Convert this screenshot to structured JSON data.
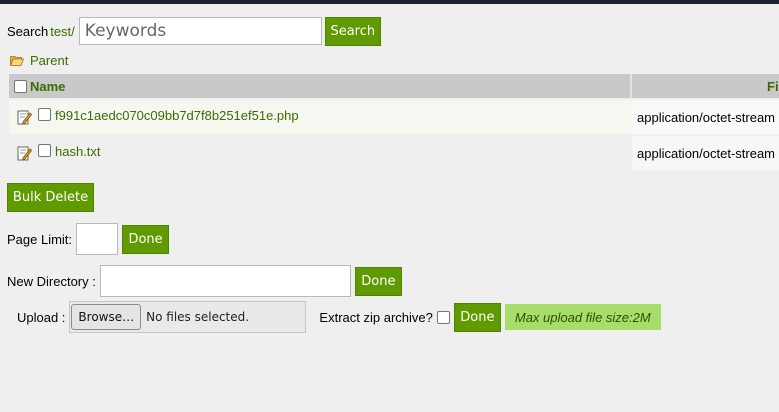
{
  "search": {
    "label": "Search",
    "path": "test/",
    "placeholder": "Keywords",
    "button": "Search"
  },
  "parent": {
    "label": "Parent",
    "icon": "folder-open-icon"
  },
  "table": {
    "headers": {
      "name": "Name",
      "type": "Fi"
    },
    "rows": [
      {
        "name": "f991c1aedc070c09bb7d7f8b251ef51e.php",
        "type": "application/octet-stream",
        "icon": "edit-icon"
      },
      {
        "name": "hash.txt",
        "type": "application/octet-stream",
        "icon": "edit-icon"
      }
    ]
  },
  "bulk_delete": "Bulk Delete",
  "page_limit": {
    "label": "Page Limit:",
    "button": "Done"
  },
  "new_directory": {
    "label": "New Directory :",
    "button": "Done"
  },
  "upload": {
    "label": "Upload :",
    "browse": "Browse…",
    "no_file": "No files selected.",
    "extract_label": "Extract zip archive?",
    "button": "Done",
    "max_size": "Max upload file size:2M"
  },
  "colors": {
    "accent": "#5f9a00",
    "link": "#3d6b00",
    "topbar": "#1c2230",
    "header_bg": "#c9c9c9",
    "notice_bg": "#a7dd6a"
  }
}
